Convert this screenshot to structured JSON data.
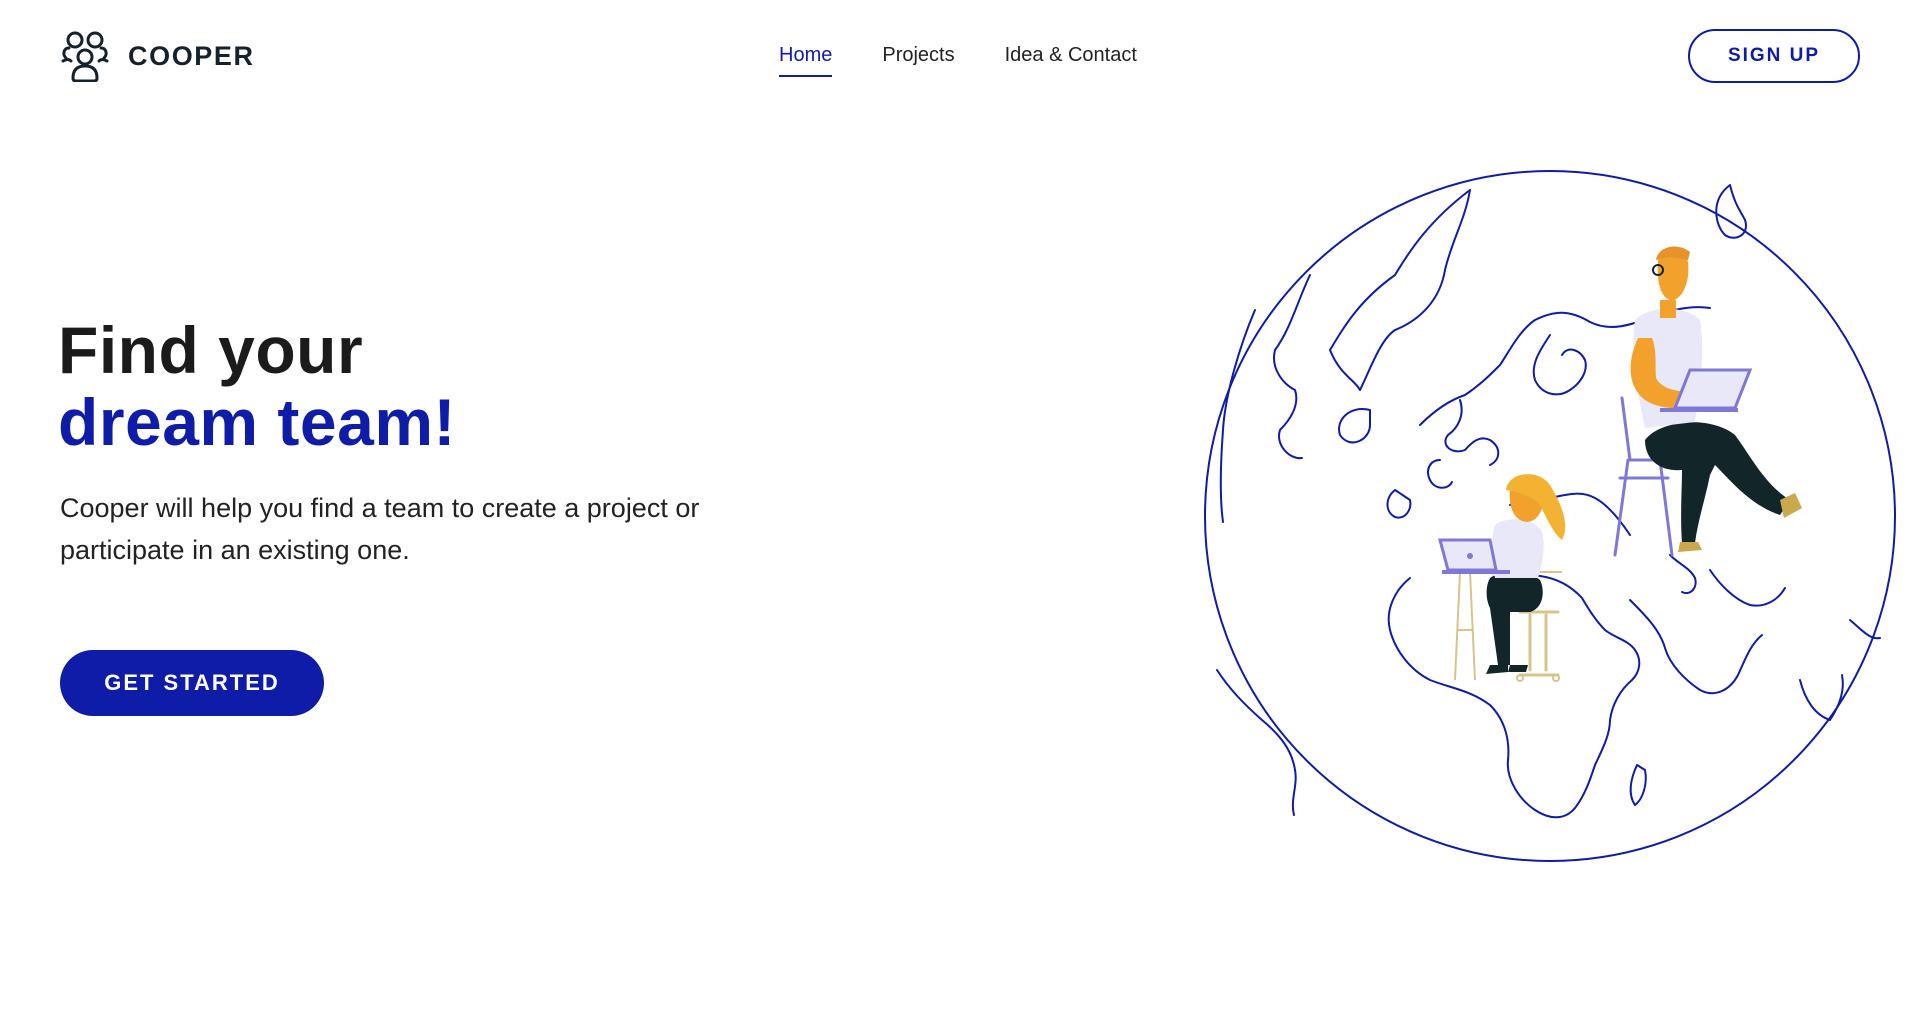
{
  "brand": {
    "name": "COOPER",
    "logo_icon": "people-group-icon"
  },
  "nav": {
    "items": [
      {
        "label": "Home",
        "active": true
      },
      {
        "label": "Projects",
        "active": false
      },
      {
        "label": "Idea & Contact",
        "active": false
      }
    ]
  },
  "header": {
    "signup_label": "SIGN UP"
  },
  "hero": {
    "title_line1": "Find your",
    "title_line2": "dream team!",
    "description": "Cooper will help you find a team to create a project or participate in an existing one.",
    "cta_label": "GET STARTED"
  },
  "illustration": {
    "subject": "world-map-globe-with-remote-workers-illustration"
  },
  "colors": {
    "accent": "#0f1ca8",
    "text": "#1b1b1b",
    "background": "#ffffff",
    "skin": "#f2a22c",
    "shirt": "#e8e8f8",
    "pants": "#12262a",
    "laptop": "#7f78d8"
  }
}
